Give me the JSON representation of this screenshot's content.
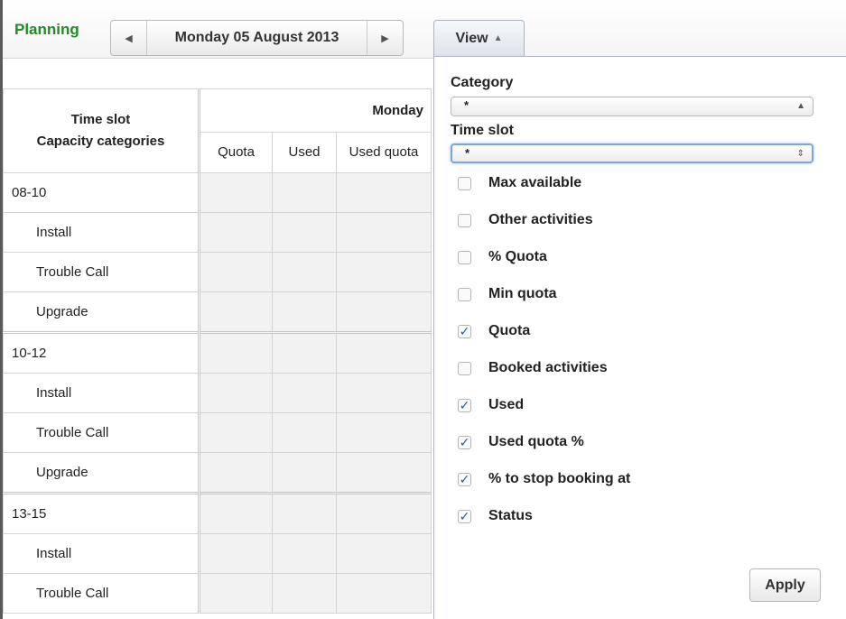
{
  "toolbar": {
    "title": "Planning",
    "prev_icon": "triangle-left",
    "date": "Monday 05 August 2013",
    "next_icon": "triangle-right",
    "view_label": "View",
    "view_icon": "triangle-up"
  },
  "grid": {
    "header_line1": "Time slot",
    "header_line2": "Capacity categories",
    "day": "Monday",
    "columns": [
      "Quota",
      "Used",
      "Used quota"
    ],
    "rows": [
      {
        "label": "08-10",
        "level": 0
      },
      {
        "label": "Install",
        "level": 1
      },
      {
        "label": "Trouble Call",
        "level": 1
      },
      {
        "label": "Upgrade",
        "level": 1
      },
      {
        "label": "10-12",
        "level": 0
      },
      {
        "label": "Install",
        "level": 1
      },
      {
        "label": "Trouble Call",
        "level": 1
      },
      {
        "label": "Upgrade",
        "level": 1
      },
      {
        "label": "13-15",
        "level": 0
      },
      {
        "label": "Install",
        "level": 1
      },
      {
        "label": "Trouble Call",
        "level": 1
      }
    ]
  },
  "view_panel": {
    "category_label": "Category",
    "category_value": "*",
    "timeslot_label": "Time slot",
    "timeslot_value": "*",
    "options": [
      {
        "label": "Max available",
        "checked": false
      },
      {
        "label": "Other activities",
        "checked": false
      },
      {
        "label": "% Quota",
        "checked": false
      },
      {
        "label": "Min quota",
        "checked": false
      },
      {
        "label": "Quota",
        "checked": true
      },
      {
        "label": "Booked activities",
        "checked": false
      },
      {
        "label": "Used",
        "checked": true
      },
      {
        "label": "Used quota %",
        "checked": true
      },
      {
        "label": "% to stop booking at",
        "checked": true
      },
      {
        "label": "Status",
        "checked": true
      }
    ],
    "apply_label": "Apply"
  },
  "colors": {
    "planning_green": "#238b23",
    "checkmark_blue": "#2a5aa8",
    "focus_ring": "#7ea6d8"
  }
}
